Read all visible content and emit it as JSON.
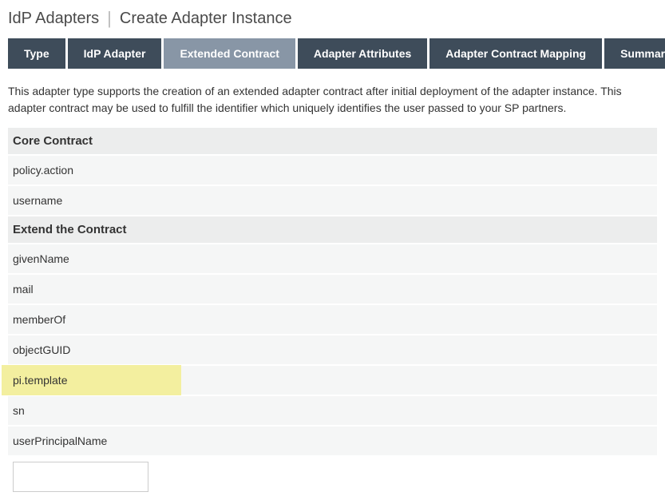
{
  "breadcrumb": {
    "parent": "IdP Adapters",
    "current": "Create Adapter Instance"
  },
  "tabs": [
    {
      "label": "Type"
    },
    {
      "label": "IdP Adapter"
    },
    {
      "label": "Extended Contract"
    },
    {
      "label": "Adapter Attributes"
    },
    {
      "label": "Adapter Contract Mapping"
    },
    {
      "label": "Summary"
    }
  ],
  "description": "This adapter type supports the creation of an extended adapter contract after initial deployment of the adapter instance. This adapter contract may be used to fulfill the identifier which uniquely identifies the user passed to your SP partners.",
  "sections": {
    "core_header": "Core Contract",
    "core_items": [
      "policy.action",
      "username"
    ],
    "extend_header": "Extend the Contract",
    "extend_items": [
      {
        "label": "givenName",
        "highlight": false
      },
      {
        "label": "mail",
        "highlight": false
      },
      {
        "label": "memberOf",
        "highlight": false
      },
      {
        "label": "objectGUID",
        "highlight": false
      },
      {
        "label": "pi.template",
        "highlight": true
      },
      {
        "label": "sn",
        "highlight": false
      },
      {
        "label": "userPrincipalName",
        "highlight": false
      }
    ]
  },
  "input": {
    "value": ""
  }
}
